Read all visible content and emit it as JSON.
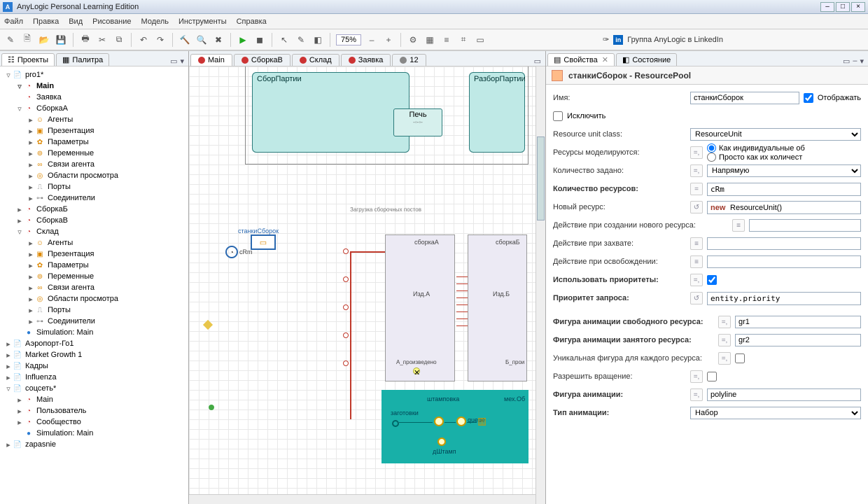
{
  "title": "AnyLogic Personal Learning Edition",
  "menus": [
    "Файл",
    "Правка",
    "Вид",
    "Рисование",
    "Модель",
    "Инструменты",
    "Справка"
  ],
  "toolbar": {
    "zoom": "75%",
    "link_label": "Группа AnyLogic в LinkedIn"
  },
  "left_tabs": {
    "projects": "Проекты",
    "palette": "Палитра"
  },
  "tree": [
    {
      "d": 0,
      "t": "▿",
      "i": "📄",
      "c": "icn-blue",
      "l": "pro1*"
    },
    {
      "d": 1,
      "t": "▿",
      "i": "◔",
      "c": "icn-red",
      "l": "Main",
      "b": true
    },
    {
      "d": 1,
      "t": "",
      "i": "◔",
      "c": "icn-red",
      "l": "Заявка"
    },
    {
      "d": 1,
      "t": "▿",
      "i": "◔",
      "c": "icn-red",
      "l": "СборкаА"
    },
    {
      "d": 2,
      "t": "▸",
      "i": "☺",
      "c": "icn-org",
      "l": "Агенты"
    },
    {
      "d": 2,
      "t": "▸",
      "i": "▣",
      "c": "icn-org",
      "l": "Презентация"
    },
    {
      "d": 2,
      "t": "▸",
      "i": "✿",
      "c": "icn-org",
      "l": "Параметры"
    },
    {
      "d": 2,
      "t": "▸",
      "i": "⊚",
      "c": "icn-org",
      "l": "Переменные"
    },
    {
      "d": 2,
      "t": "▸",
      "i": "∞",
      "c": "icn-org",
      "l": "Связи агента"
    },
    {
      "d": 2,
      "t": "▸",
      "i": "◎",
      "c": "icn-org",
      "l": "Области просмотра"
    },
    {
      "d": 2,
      "t": "▸",
      "i": "⎍",
      "c": "icn-gray",
      "l": "Порты"
    },
    {
      "d": 2,
      "t": "▸",
      "i": "⊶",
      "c": "icn-gray",
      "l": "Соединители"
    },
    {
      "d": 1,
      "t": "▸",
      "i": "◔",
      "c": "icn-red",
      "l": "СборкаБ"
    },
    {
      "d": 1,
      "t": "▸",
      "i": "◔",
      "c": "icn-red",
      "l": "СборкаВ"
    },
    {
      "d": 1,
      "t": "▿",
      "i": "◔",
      "c": "icn-red",
      "l": "Склад"
    },
    {
      "d": 2,
      "t": "▸",
      "i": "☺",
      "c": "icn-org",
      "l": "Агенты"
    },
    {
      "d": 2,
      "t": "▸",
      "i": "▣",
      "c": "icn-org",
      "l": "Презентация"
    },
    {
      "d": 2,
      "t": "▸",
      "i": "✿",
      "c": "icn-org",
      "l": "Параметры"
    },
    {
      "d": 2,
      "t": "▸",
      "i": "⊚",
      "c": "icn-org",
      "l": "Переменные"
    },
    {
      "d": 2,
      "t": "▸",
      "i": "∞",
      "c": "icn-org",
      "l": "Связи агента"
    },
    {
      "d": 2,
      "t": "▸",
      "i": "◎",
      "c": "icn-org",
      "l": "Области просмотра"
    },
    {
      "d": 2,
      "t": "▸",
      "i": "⎍",
      "c": "icn-gray",
      "l": "Порты"
    },
    {
      "d": 2,
      "t": "▸",
      "i": "⊶",
      "c": "icn-gray",
      "l": "Соединители"
    },
    {
      "d": 1,
      "t": "",
      "i": "●",
      "c": "icn-blue",
      "l": "Simulation: Main"
    },
    {
      "d": 0,
      "t": "▸",
      "i": "📄",
      "c": "icn-blue",
      "l": "Аэропорт-Го1"
    },
    {
      "d": 0,
      "t": "▸",
      "i": "📄",
      "c": "icn-blue",
      "l": "Market Growth 1"
    },
    {
      "d": 0,
      "t": "▸",
      "i": "📄",
      "c": "icn-blue",
      "l": "Кадры"
    },
    {
      "d": 0,
      "t": "▸",
      "i": "📄",
      "c": "icn-blue",
      "l": "Influenza"
    },
    {
      "d": 0,
      "t": "▿",
      "i": "📄",
      "c": "icn-blue",
      "l": "соцсеть*"
    },
    {
      "d": 1,
      "t": "▸",
      "i": "◔",
      "c": "icn-red",
      "l": "Main"
    },
    {
      "d": 1,
      "t": "▸",
      "i": "◔",
      "c": "icn-red",
      "l": "Пользователь"
    },
    {
      "d": 1,
      "t": "▸",
      "i": "◔",
      "c": "icn-red",
      "l": "Сообщество"
    },
    {
      "d": 1,
      "t": "",
      "i": "●",
      "c": "icn-blue",
      "l": "Simulation: Main"
    },
    {
      "d": 0,
      "t": "▸",
      "i": "📄",
      "c": "icn-blue",
      "l": "zapasnie"
    }
  ],
  "editor_tabs": [
    {
      "l": "Main",
      "c": "#c33",
      "active": true
    },
    {
      "l": "СборкаВ",
      "c": "#c33"
    },
    {
      "l": "Склад",
      "c": "#c33"
    },
    {
      "l": "Заявка",
      "c": "#c33"
    },
    {
      "l": "12",
      "c": "#888"
    }
  ],
  "canvas": {
    "box1": "СборПартии",
    "box2": "РазборПартии",
    "box3": "Печь",
    "resname": "станкиСборок",
    "resvar": "cRm",
    "load_label": "Загрузка сборочных постов",
    "sbA": "сборкаА",
    "sbB": "сборкаБ",
    "izdA": "Изд.А",
    "izdB": "Изд.Б",
    "apro": "А_произведено",
    "bpro": "Б_прои",
    "zag": "заготовки",
    "shtamp": "штамповка",
    "mech": "мех.Об",
    "dsht": "дШтамп",
    "queue": "queue"
  },
  "right_tabs": {
    "props": "Свойства",
    "state": "Состояние"
  },
  "prop_title": "станкиСборок - ResourcePool",
  "props": {
    "name_l": "Имя:",
    "name_v": "станкиСборок",
    "show_l": "Отображать",
    "exclude_l": "Исключить",
    "unit_l": "Resource unit class:",
    "unit_v": "ResourceUnit",
    "model_l": "Ресурсы моделируются:",
    "opt1": "Как индивидуальные об",
    "opt2": "Просто как их количест",
    "cnt_def_l": "Количество задано:",
    "cnt_def_v": "Напрямую",
    "cnt_l": "Количество ресурсов:",
    "cnt_v": "cRm",
    "newres_l": "Новый ресурс:",
    "newres_kw": "new",
    "newres_v": "ResourceUnit()",
    "on_create_l": "Действие при создании нового ресурса:",
    "on_seize_l": "Действие при захвате:",
    "on_release_l": "Действие при освобождении:",
    "use_prio_l": "Использовать приоритеты:",
    "prio_l": "Приоритет запроса:",
    "prio_v": "entity.priority",
    "idle_l": "Фигура анимации свободного ресурса:",
    "idle_v": "gr1",
    "busy_l": "Фигура анимации занятого ресурса:",
    "busy_v": "gr2",
    "unique_l": "Уникальная фигура для каждого ресурса:",
    "rotate_l": "Разрешить вращение:",
    "anim_l": "Фигура анимации:",
    "anim_v": "polyline",
    "atype_l": "Тип анимации:",
    "atype_v": "Набор"
  }
}
